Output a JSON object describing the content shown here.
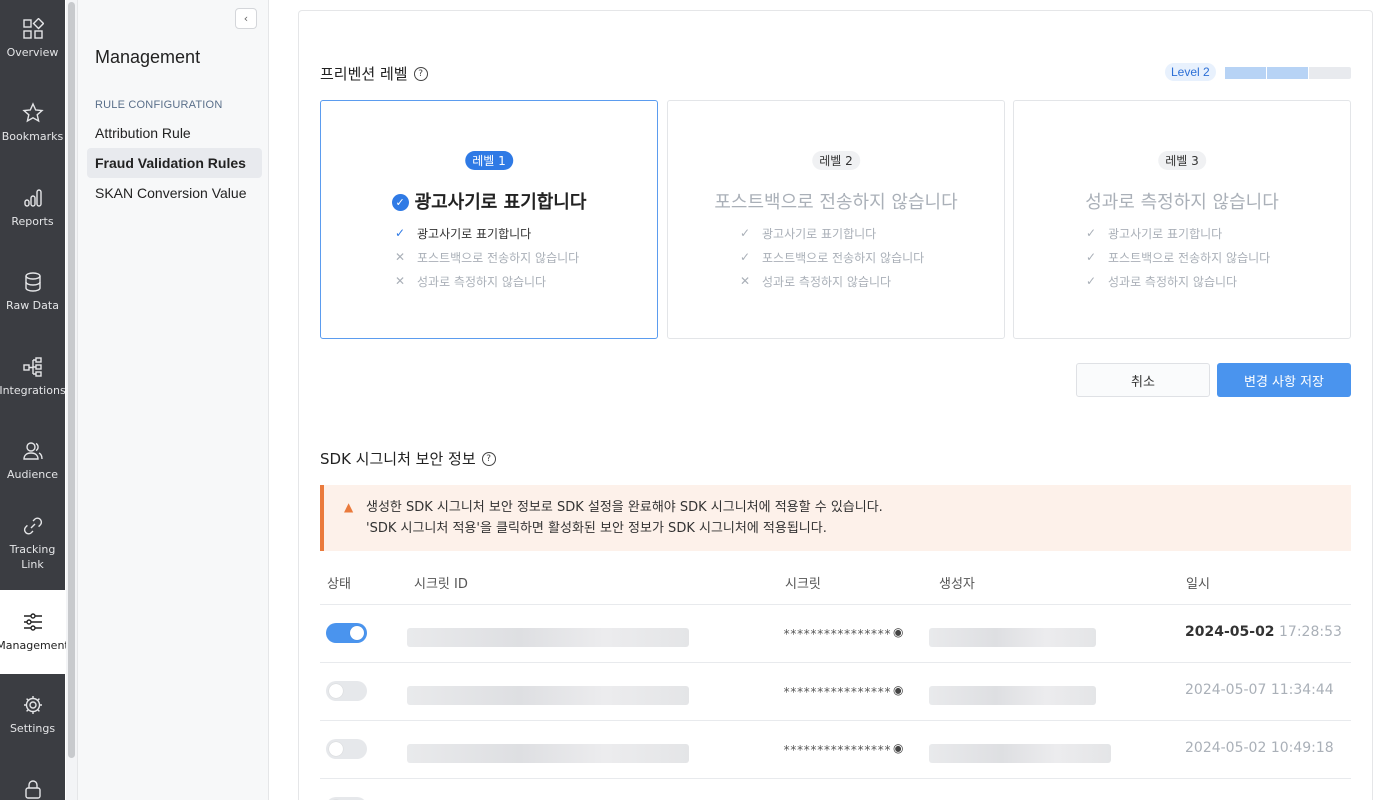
{
  "rail": {
    "items": [
      {
        "label": "Overview",
        "icon": "grid-icon"
      },
      {
        "label": "Bookmarks",
        "icon": "star-icon"
      },
      {
        "label": "Reports",
        "icon": "bar-chart-icon"
      },
      {
        "label": "Raw Data",
        "icon": "database-icon"
      },
      {
        "label": "Integrations",
        "icon": "integration-icon"
      },
      {
        "label": "Audience",
        "icon": "audience-icon"
      },
      {
        "label": "Tracking Link",
        "icon": "link-icon"
      },
      {
        "label": "Management",
        "icon": "sliders-icon",
        "active": true
      },
      {
        "label": "Settings",
        "icon": "gear-icon"
      },
      {
        "label": "",
        "icon": "lock-icon"
      }
    ]
  },
  "sidebar": {
    "collapse_glyph": "‹",
    "title": "Management",
    "section": "RULE CONFIGURATION",
    "items": [
      {
        "label": "Attribution Rule"
      },
      {
        "label": "Fraud Validation Rules",
        "active": true
      },
      {
        "label": "SKAN Conversion Value"
      }
    ]
  },
  "prevention": {
    "title": "프리벤션 레벨",
    "help_glyph": "?",
    "level_badge": "Level 2",
    "level_progress": {
      "current": 2,
      "total": 3
    },
    "cards": [
      {
        "pill": "레벨 1",
        "heading": "광고사기로 표기합니다",
        "selected": true,
        "items": [
          {
            "text": "광고사기로 표기합니다",
            "checked": true
          },
          {
            "text": "포스트백으로 전송하지 않습니다",
            "checked": false
          },
          {
            "text": "성과로 측정하지 않습니다",
            "checked": false
          }
        ]
      },
      {
        "pill": "레벨 2",
        "heading": "포스트백으로 전송하지 않습니다",
        "selected": false,
        "items": [
          {
            "text": "광고사기로 표기합니다",
            "checked": true
          },
          {
            "text": "포스트백으로 전송하지 않습니다",
            "checked": true
          },
          {
            "text": "성과로 측정하지 않습니다",
            "checked": false
          }
        ]
      },
      {
        "pill": "레벨 3",
        "heading": "성과로 측정하지 않습니다",
        "selected": false,
        "items": [
          {
            "text": "광고사기로 표기합니다",
            "checked": true
          },
          {
            "text": "포스트백으로 전송하지 않습니다",
            "checked": true
          },
          {
            "text": "성과로 측정하지 않습니다",
            "checked": true
          }
        ]
      }
    ],
    "cancel_label": "취소",
    "save_label": "변경 사항 저장"
  },
  "sdk": {
    "title": "SDK 시그니처 보안 정보",
    "help_glyph": "?",
    "alert_line1": "생성한 SDK 시그니처 보안 정보로 SDK 설정을 완료해야 SDK 시그니처에 적용할 수 있습니다.",
    "alert_line2": "'SDK 시그니처 적용'을 클릭하면 활성화된 보안 정보가 SDK 시그니처에 적용됩니다.",
    "columns": {
      "status": "상태",
      "secret_id": "시크릿 ID",
      "secret": "시크릿",
      "creator": "생성자",
      "date": "일시"
    },
    "rows": [
      {
        "enabled": true,
        "secret": "****************",
        "date": "2024-05-02",
        "time": "17:28:53"
      },
      {
        "enabled": false,
        "secret": "****************",
        "date": "2024-05-07",
        "time": "11:34:44"
      },
      {
        "enabled": false,
        "secret": "****************",
        "date": "2024-05-02",
        "time": "10:49:18"
      }
    ]
  },
  "colors": {
    "accent": "#4a94ee",
    "rail": "#3b3d42",
    "warning": "#ea7a3c"
  }
}
